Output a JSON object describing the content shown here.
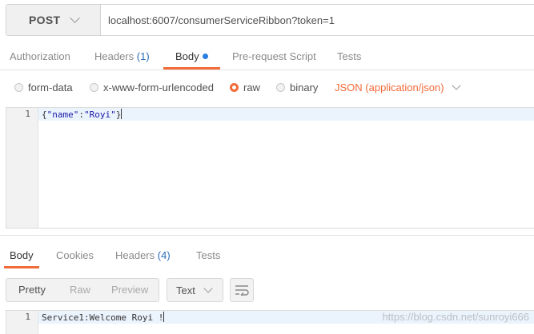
{
  "request": {
    "method": "POST",
    "url": "localhost:6007/consumerServiceRibbon?token=1"
  },
  "request_tabs": {
    "authorization": "Authorization",
    "headers": "Headers",
    "headers_count": "(1)",
    "body": "Body",
    "prerequest": "Pre-request Script",
    "tests": "Tests"
  },
  "body_types": {
    "form_data": "form-data",
    "urlencoded": "x-www-form-urlencoded",
    "raw": "raw",
    "binary": "binary",
    "selected": "raw",
    "content_type": "JSON (application/json)"
  },
  "request_editor": {
    "line_number": "1",
    "brace_open": "{",
    "key": "\"name\"",
    "colon": ":",
    "value": "\"Royi\"",
    "brace_close": "}"
  },
  "response_tabs": {
    "body": "Body",
    "cookies": "Cookies",
    "headers": "Headers",
    "headers_count": "(4)",
    "tests": "Tests"
  },
  "response_toolbar": {
    "pretty": "Pretty",
    "raw": "Raw",
    "preview": "Preview",
    "format": "Text"
  },
  "response_editor": {
    "line_number": "1",
    "text": "Service1:Welcome Royi !"
  },
  "watermark": "https://blog.csdn.net/sunroyi666",
  "colors": {
    "accent": "#f26b3a",
    "count_blue": "#2a6ebb",
    "dot_blue": "#2a7de1",
    "string_blue": "#1a1aa6"
  },
  "icons": {
    "method_dropdown": "chevron-down-icon",
    "content_type_dropdown": "chevron-down-icon",
    "format_dropdown": "chevron-down-icon",
    "wrap": "wrap-lines-icon",
    "body_indicator": "dot-icon"
  }
}
